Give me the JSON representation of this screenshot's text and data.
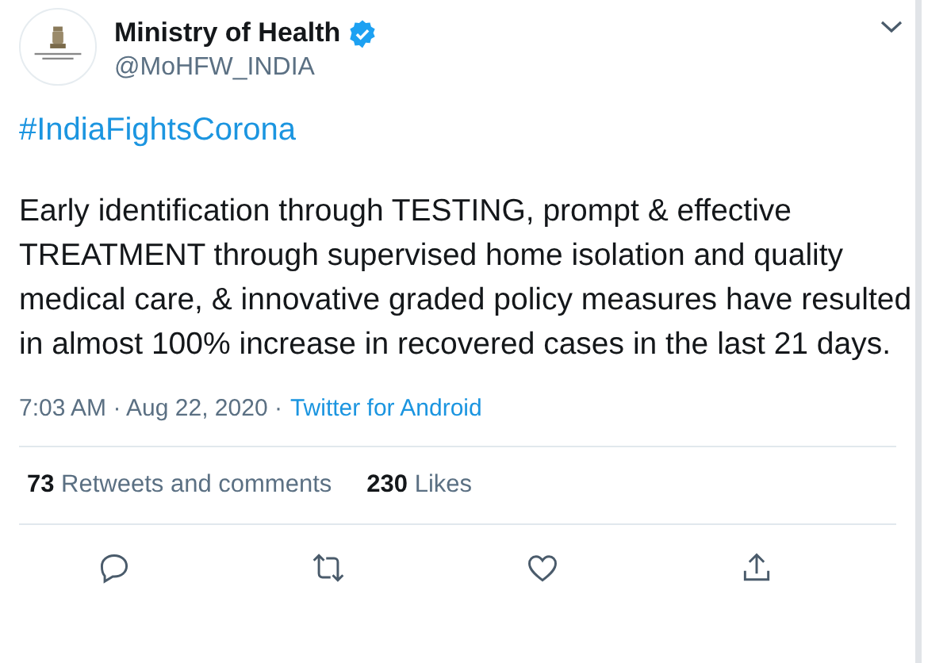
{
  "author": {
    "name": "Ministry of Health",
    "verified": true,
    "handle": "@MoHFW_INDIA"
  },
  "tweet": {
    "hashtag": "#IndiaFightsCorona",
    "text": "Early identification through TESTING, prompt & effective TREATMENT through supervised home isolation and quality medical care, & innovative graded policy measures have resulted in almost 100% increase in recovered cases in the last 21 days."
  },
  "meta": {
    "time": "7:03 AM · Aug 22, 2020 ·",
    "source": "Twitter for Android"
  },
  "stats": [
    {
      "count": "73",
      "label": "Retweets and comments"
    },
    {
      "count": "230",
      "label": "Likes"
    }
  ],
  "actions": [
    {
      "kind": "reply"
    },
    {
      "kind": "retweet"
    },
    {
      "kind": "like"
    },
    {
      "kind": "share"
    }
  ]
}
